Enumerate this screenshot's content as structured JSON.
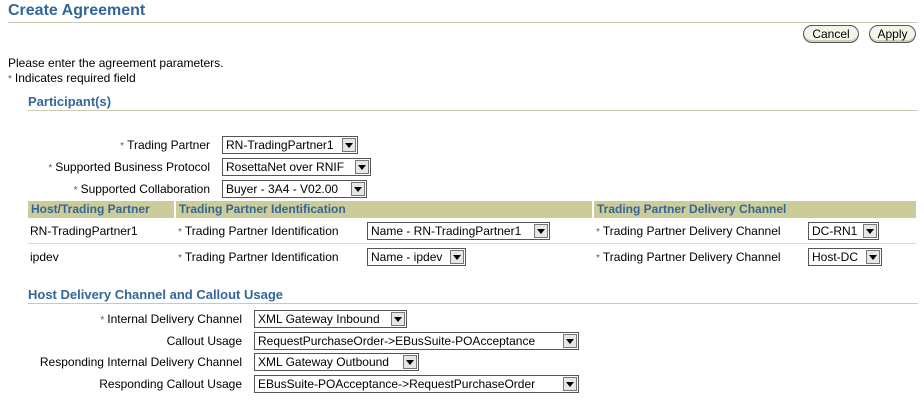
{
  "page": {
    "title": "Create Agreement",
    "intro": "Please enter the agreement parameters.",
    "required_note": "Indicates required field",
    "required_marker": "*"
  },
  "buttons": {
    "cancel": "Cancel",
    "apply": "Apply"
  },
  "participants": {
    "title": "Participant(s)",
    "trading_partner": {
      "label": "Trading Partner",
      "value": "RN-TradingPartner1"
    },
    "business_protocol": {
      "label": "Supported Business Protocol",
      "value": "RosettaNet over RNIF"
    },
    "collaboration": {
      "label": "Supported Collaboration",
      "value": "Buyer - 3A4 - V02.00"
    },
    "table": {
      "headers": [
        "Host/Trading Partner",
        "Trading Partner Identification",
        "Trading Partner Delivery Channel"
      ],
      "rows": [
        {
          "partner": "RN-TradingPartner1",
          "id_label": "Trading Partner Identification",
          "id_value": "Name - RN-TradingPartner1",
          "channel_label": "Trading Partner Delivery Channel",
          "channel_value": "DC-RN1"
        },
        {
          "partner": "ipdev",
          "id_label": "Trading Partner Identification",
          "id_value": "Name - ipdev",
          "channel_label": "Trading Partner Delivery Channel",
          "channel_value": "Host-DC"
        }
      ]
    }
  },
  "host": {
    "title": "Host Delivery Channel and Callout Usage",
    "internal_channel": {
      "label": "Internal Delivery Channel",
      "value": "XML Gateway Inbound"
    },
    "callout_usage": {
      "label": "Callout Usage",
      "value": "RequestPurchaseOrder->EBusSuite-POAcceptance"
    },
    "responding_channel": {
      "label": "Responding Internal Delivery Channel",
      "value": "XML Gateway Outbound"
    },
    "responding_callout": {
      "label": "Responding Callout Usage",
      "value": "EBusSuite-POAcceptance->RequestPurchaseOrder"
    }
  },
  "colors": {
    "accent": "#336699",
    "table_header_bg": "#cccc99",
    "rule": "#c9cbb0"
  }
}
